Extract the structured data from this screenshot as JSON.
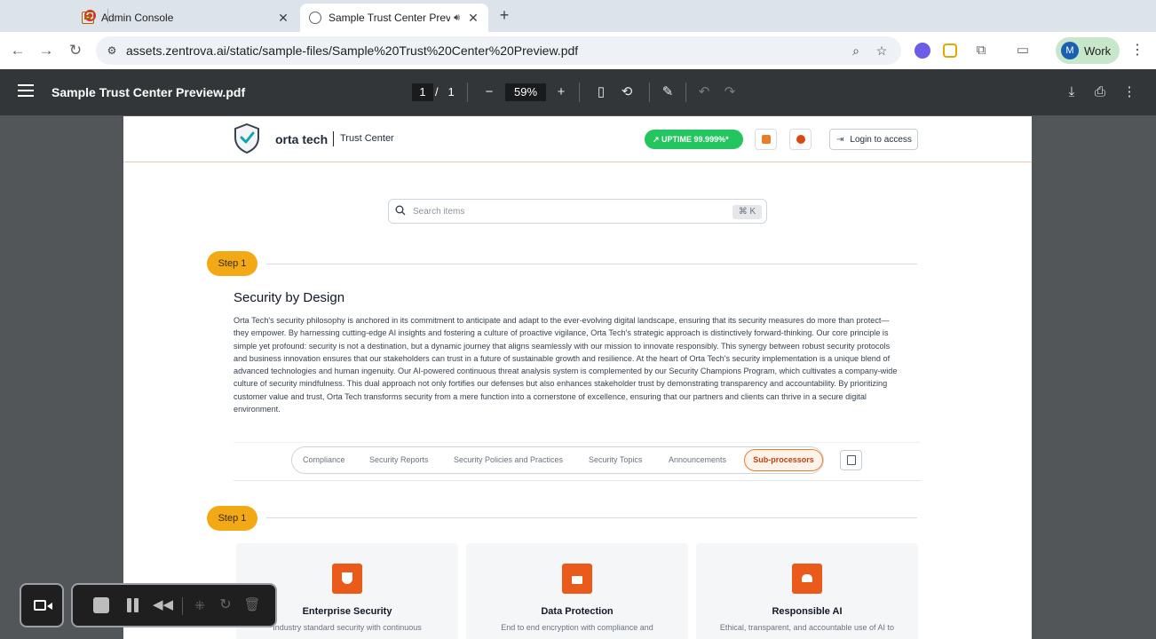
{
  "browser": {
    "tabs": [
      {
        "title": "Admin Console"
      },
      {
        "title": "Sample Trust Center Preview.pdf"
      }
    ],
    "url": "assets.zentrova.ai/static/sample-files/Sample%20Trust%20Center%20Preview.pdf",
    "profile": {
      "initial": "M",
      "label": "Work"
    }
  },
  "pdf_viewer": {
    "title": "Sample Trust Center Preview.pdf",
    "current_page": "1",
    "page_sep": "/",
    "total_pages": "1",
    "zoom": "59%"
  },
  "trust_center": {
    "brand": "orta tech",
    "subtitle": "Trust Center",
    "uptime": "UPTIME 99.999%*",
    "login_label": "Login to access",
    "search_placeholder": "Search items",
    "search_shortcut": "⌘ K",
    "steps": [
      {
        "label": "Step 1"
      },
      {
        "label": "Step 1"
      }
    ],
    "section_title": "Security by Design",
    "section_body": "Orta Tech's security philosophy is anchored in its commitment to anticipate and adapt to the ever-evolving digital landscape, ensuring that its security measures do more than protect—they empower. By harnessing cutting-edge AI insights and fostering a culture of proactive vigilance, Orta Tech's strategic approach is distinctively forward-thinking. Our core principle is simple yet profound: security is not a destination, but a dynamic journey that aligns seamlessly with our mission to innovate responsibly. This synergy between robust security protocols and business innovation ensures that our stakeholders can trust in a future of sustainable growth and resilience. At the heart of Orta Tech's security implementation is a unique blend of advanced technologies and human ingenuity. Our AI-powered continuous threat analysis system is complemented by our Security Champions Program, which cultivates a company-wide culture of security mindfulness. This dual approach not only fortifies our defenses but also enhances stakeholder trust by demonstrating transparency and accountability. By prioritizing customer value and trust, Orta Tech transforms security from a mere function into a cornerstone of excellence, ensuring that our partners and clients can thrive in a secure digital environment.",
    "tabs": [
      {
        "label": "Compliance"
      },
      {
        "label": "Security Reports"
      },
      {
        "label": "Security Policies and Practices"
      },
      {
        "label": "Security Topics"
      },
      {
        "label": "Announcements"
      },
      {
        "label": "Sub-processors"
      }
    ],
    "active_tab": "Sub-processors",
    "cards": [
      {
        "title": "Enterprise Security",
        "desc": "Industry standard security with continuous",
        "icon": "shield-icon"
      },
      {
        "title": "Data Protection",
        "desc": "End to end encryption with compliance and",
        "icon": "lock-icon"
      },
      {
        "title": "Responsible AI",
        "desc": "Ethical, transparent, and accountable use of AI to",
        "icon": "people-icon"
      }
    ]
  },
  "colors": {
    "accent_orange": "#ea5a1b",
    "step_yellow": "#f2a915",
    "uptime_green": "#22c55e",
    "pdf_toolbar": "#323639",
    "viewer_bg": "#525659"
  }
}
